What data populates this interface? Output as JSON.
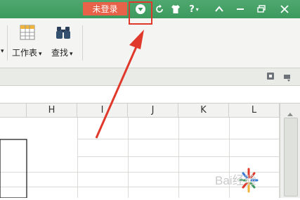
{
  "titlebar": {
    "login_label": "未登录",
    "icons": [
      "skin-icon",
      "sync-icon",
      "shirt-icon",
      "help-icon",
      "collapse-icon",
      "minimize-icon",
      "restore-icon",
      "close-icon"
    ],
    "help_label": "?"
  },
  "ribbon": {
    "worksheet_label": "工作表",
    "find_label": "查找",
    "dropdown_glyph": "▾"
  },
  "columns": [
    "H",
    "I",
    "J",
    "K",
    "L"
  ],
  "watermark_text": "Bai经验",
  "colors": {
    "titlebar": "#3c9a5e",
    "login_button": "#e8624a",
    "highlight": "#e0392b"
  }
}
